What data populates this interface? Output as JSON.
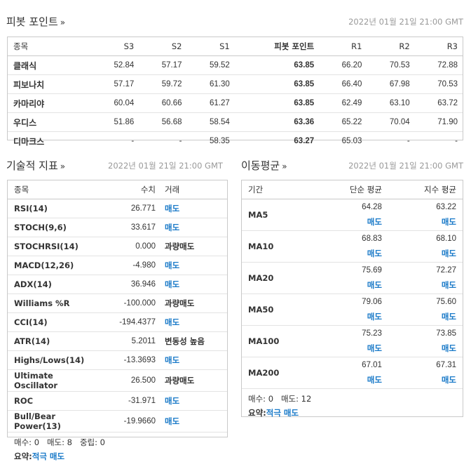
{
  "pivot": {
    "title": "피봇 포인트",
    "arrow": "»",
    "timestamp": "2022년 01월 21일 21:00 GMT",
    "headers": [
      "종목",
      "S3",
      "S2",
      "S1",
      "피봇 포인트",
      "R1",
      "R2",
      "R3"
    ],
    "rows": [
      [
        "클래식",
        "52.84",
        "57.17",
        "59.52",
        "63.85",
        "66.20",
        "70.53",
        "72.88"
      ],
      [
        "피보나치",
        "57.17",
        "59.72",
        "61.30",
        "63.85",
        "66.40",
        "67.98",
        "70.53"
      ],
      [
        "카마리야",
        "60.04",
        "60.66",
        "61.27",
        "63.85",
        "62.49",
        "63.10",
        "63.72"
      ],
      [
        "우디스",
        "51.86",
        "56.68",
        "58.54",
        "63.36",
        "65.22",
        "70.04",
        "71.90"
      ],
      [
        "디마크스",
        "-",
        "-",
        "58.35",
        "63.27",
        "65.03",
        "-",
        "-"
      ]
    ]
  },
  "tech": {
    "title": "기술적 지표",
    "arrow": "»",
    "timestamp": "2022년 01월 21일 21:00 GMT",
    "headers": [
      "종목",
      "수치",
      "거래"
    ],
    "rows": [
      {
        "name": "RSI(14)",
        "value": "26.771",
        "action": "매도",
        "sell": true
      },
      {
        "name": "STOCH(9,6)",
        "value": "33.617",
        "action": "매도",
        "sell": true
      },
      {
        "name": "STOCHRSI(14)",
        "value": "0.000",
        "action": "과량매도",
        "sell": false
      },
      {
        "name": "MACD(12,26)",
        "value": "-4.980",
        "action": "매도",
        "sell": true
      },
      {
        "name": "ADX(14)",
        "value": "36.946",
        "action": "매도",
        "sell": true
      },
      {
        "name": "Williams %R",
        "value": "-100.000",
        "action": "과량매도",
        "sell": false
      },
      {
        "name": "CCI(14)",
        "value": "-194.4377",
        "action": "매도",
        "sell": true
      },
      {
        "name": "ATR(14)",
        "value": "5.2011",
        "action": "변동성 높음",
        "sell": false
      },
      {
        "name": "Highs/Lows(14)",
        "value": "-13.3693",
        "action": "매도",
        "sell": true
      },
      {
        "name": "Ultimate Oscillator",
        "value": "26.500",
        "action": "과량매도",
        "sell": false
      },
      {
        "name": "ROC",
        "value": "-31.971",
        "action": "매도",
        "sell": true
      },
      {
        "name": "Bull/Bear Power(13)",
        "value": "-19.9660",
        "action": "매도",
        "sell": true
      }
    ],
    "counts": "매수: 0   매도: 8   중립: 0",
    "summary_label": "요약:",
    "summary_value": "적극 매도"
  },
  "ma": {
    "title": "이동평균",
    "arrow": "»",
    "timestamp": "2022년 01월 21일 21:00 GMT",
    "headers": [
      "기간",
      "단순 평균",
      "지수 평균"
    ],
    "rows": [
      {
        "period": "MA5",
        "simple": "64.28",
        "simple_sig": "매도",
        "exp": "63.22",
        "exp_sig": "매도"
      },
      {
        "period": "MA10",
        "simple": "68.83",
        "simple_sig": "매도",
        "exp": "68.10",
        "exp_sig": "매도"
      },
      {
        "period": "MA20",
        "simple": "75.69",
        "simple_sig": "매도",
        "exp": "72.27",
        "exp_sig": "매도"
      },
      {
        "period": "MA50",
        "simple": "79.06",
        "simple_sig": "매도",
        "exp": "75.60",
        "exp_sig": "매도"
      },
      {
        "period": "MA100",
        "simple": "75.23",
        "simple_sig": "매도",
        "exp": "73.85",
        "exp_sig": "매도"
      },
      {
        "period": "MA200",
        "simple": "67.01",
        "simple_sig": "매도",
        "exp": "67.31",
        "exp_sig": "매도"
      }
    ],
    "counts": "매수: 0   매도: 12",
    "summary_label": "요약:",
    "summary_value": "적극 매도"
  },
  "colors": {
    "sell": "#1a7ac8",
    "border": "#c9c9c9",
    "timestamp": "#999999"
  }
}
